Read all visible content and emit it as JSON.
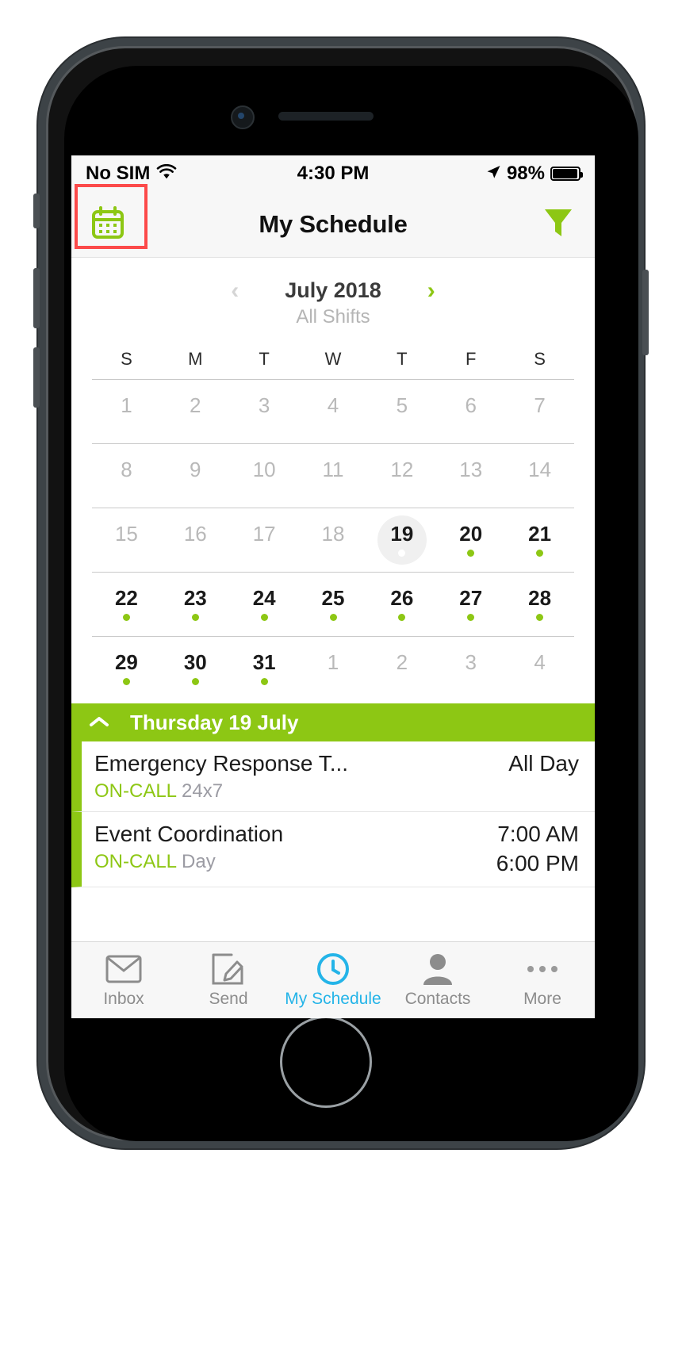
{
  "status_bar": {
    "carrier": "No SIM",
    "wifi_icon": "wifi-icon",
    "time": "4:30 PM",
    "location_icon": "location-arrow-icon",
    "battery_percent": "98%",
    "battery_icon": "battery-icon"
  },
  "nav_bar": {
    "calendar_icon": "calendar-icon",
    "title": "My Schedule",
    "filter_icon": "funnel-filter-icon"
  },
  "calendar": {
    "prev_icon": "chevron-left-icon",
    "month_label": "July 2018",
    "next_icon": "chevron-right-icon",
    "shift_filter": "All Shifts",
    "weekdays": [
      "S",
      "M",
      "T",
      "W",
      "T",
      "F",
      "S"
    ],
    "weeks": [
      [
        {
          "num": "1",
          "state": "muted",
          "dot": "none"
        },
        {
          "num": "2",
          "state": "muted",
          "dot": "none"
        },
        {
          "num": "3",
          "state": "muted",
          "dot": "none"
        },
        {
          "num": "4",
          "state": "muted",
          "dot": "none"
        },
        {
          "num": "5",
          "state": "muted",
          "dot": "none"
        },
        {
          "num": "6",
          "state": "muted",
          "dot": "none"
        },
        {
          "num": "7",
          "state": "muted",
          "dot": "none"
        }
      ],
      [
        {
          "num": "8",
          "state": "muted",
          "dot": "none"
        },
        {
          "num": "9",
          "state": "muted",
          "dot": "none"
        },
        {
          "num": "10",
          "state": "muted",
          "dot": "none"
        },
        {
          "num": "11",
          "state": "muted",
          "dot": "none"
        },
        {
          "num": "12",
          "state": "muted",
          "dot": "none"
        },
        {
          "num": "13",
          "state": "muted",
          "dot": "none"
        },
        {
          "num": "14",
          "state": "muted",
          "dot": "none"
        }
      ],
      [
        {
          "num": "15",
          "state": "muted",
          "dot": "none"
        },
        {
          "num": "16",
          "state": "muted",
          "dot": "none"
        },
        {
          "num": "17",
          "state": "muted",
          "dot": "none"
        },
        {
          "num": "18",
          "state": "muted",
          "dot": "none"
        },
        {
          "num": "19",
          "state": "selected",
          "dot": "white"
        },
        {
          "num": "20",
          "state": "active",
          "dot": "green"
        },
        {
          "num": "21",
          "state": "active",
          "dot": "green"
        }
      ],
      [
        {
          "num": "22",
          "state": "active",
          "dot": "green"
        },
        {
          "num": "23",
          "state": "active",
          "dot": "green"
        },
        {
          "num": "24",
          "state": "active",
          "dot": "green"
        },
        {
          "num": "25",
          "state": "active",
          "dot": "green"
        },
        {
          "num": "26",
          "state": "active",
          "dot": "green"
        },
        {
          "num": "27",
          "state": "active",
          "dot": "green"
        },
        {
          "num": "28",
          "state": "active",
          "dot": "green"
        }
      ],
      [
        {
          "num": "29",
          "state": "active",
          "dot": "green"
        },
        {
          "num": "30",
          "state": "active",
          "dot": "green"
        },
        {
          "num": "31",
          "state": "active",
          "dot": "green"
        },
        {
          "num": "1",
          "state": "muted",
          "dot": "none"
        },
        {
          "num": "2",
          "state": "muted",
          "dot": "none"
        },
        {
          "num": "3",
          "state": "muted",
          "dot": "none"
        },
        {
          "num": "4",
          "state": "muted",
          "dot": "none"
        }
      ]
    ]
  },
  "day_section": {
    "collapse_icon": "chevron-up-icon",
    "title": "Thursday 19 July"
  },
  "events": [
    {
      "title": "Emergency Response T...",
      "tag": "ON-CALL",
      "description": "24x7",
      "time_start": "All Day",
      "time_end": ""
    },
    {
      "title": "Event Coordination",
      "tag": "ON-CALL",
      "description": "Day",
      "time_start": "7:00 AM",
      "time_end": "6:00 PM"
    }
  ],
  "tab_bar": [
    {
      "label": "Inbox",
      "icon": "envelope-icon",
      "active": false
    },
    {
      "label": "Send",
      "icon": "compose-pencil-icon",
      "active": false
    },
    {
      "label": "My Schedule",
      "icon": "clock-icon",
      "active": true
    },
    {
      "label": "Contacts",
      "icon": "person-icon",
      "active": false
    },
    {
      "label": "More",
      "icon": "ellipsis-icon",
      "active": false
    }
  ],
  "colors": {
    "brand_green": "#8dc714",
    "active_blue": "#24b4e8",
    "highlight_red": "#fc4a4a"
  }
}
